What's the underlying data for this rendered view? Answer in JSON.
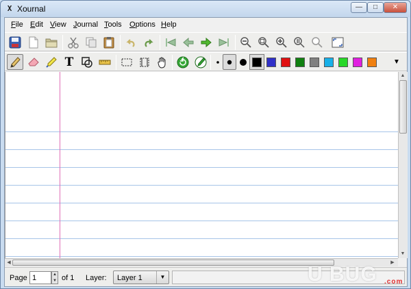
{
  "window": {
    "title": "Xournal",
    "app_icon_glyph": "X"
  },
  "title_buttons": {
    "minimize": "—",
    "maximize": "□",
    "close": "✕"
  },
  "menu": [
    "File",
    "Edit",
    "View",
    "Journal",
    "Tools",
    "Options",
    "Help"
  ],
  "toolbar1_icons": [
    "save-icon",
    "new-icon",
    "open-icon",
    "cut-icon",
    "copy-icon",
    "paste-icon",
    "undo-icon",
    "redo-icon",
    "first-page-icon",
    "previous-page-icon",
    "next-page-icon",
    "last-page-icon",
    "zoom-out-icon",
    "zoom-fit-icon",
    "zoom-in-icon",
    "zoom-100-icon",
    "zoom-custom-icon",
    "fullscreen-icon"
  ],
  "toolbar2_icons": [
    "pen-icon",
    "eraser-icon",
    "highlighter-icon",
    "text-icon",
    "shape-recognizer-icon",
    "ruler-icon",
    "select-rectangle-icon",
    "select-region-icon",
    "hand-icon",
    "default-tool-icon",
    "default-pen-icon"
  ],
  "text_tool_glyph": "T",
  "colors": [
    "#000000",
    "#3030c8",
    "#e01010",
    "#108010",
    "#808080",
    "#18b0e8",
    "#28d828",
    "#e020e0",
    "#f08010"
  ],
  "status": {
    "page_label": "Page",
    "page_value": "1",
    "of_label": "of 1",
    "layer_label": "Layer:",
    "layer_value": "Layer 1"
  },
  "watermark": {
    "text": "U BUG",
    "suffix": ".com"
  }
}
